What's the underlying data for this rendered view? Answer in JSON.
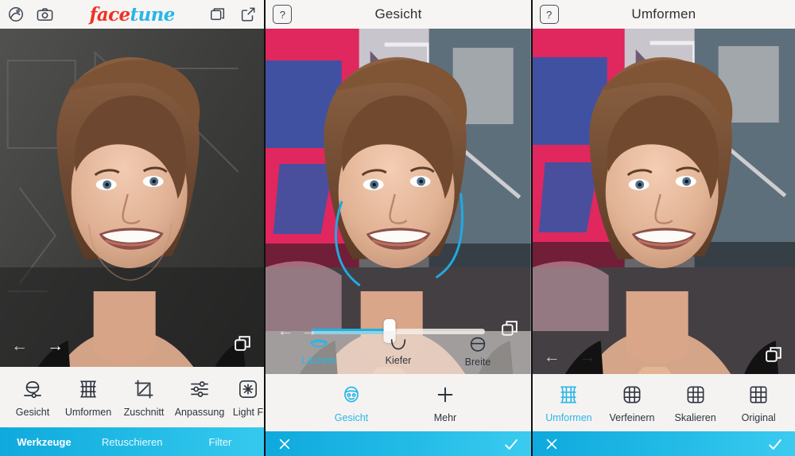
{
  "app": {
    "logo_face": "face",
    "logo_tune": "tune"
  },
  "panel1": {
    "top_icons": {
      "gallery": "gallery-icon",
      "camera": "camera-icon",
      "layers": "layers-icon",
      "share": "share-icon"
    },
    "overlay": {
      "undo": "←",
      "redo": "→",
      "compare": "compare-icon"
    },
    "tools": [
      {
        "label": "Gesicht",
        "icon": "face-slider-icon",
        "active": false
      },
      {
        "label": "Umformen",
        "icon": "warp-grid-icon",
        "active": false
      },
      {
        "label": "Zuschnitt",
        "icon": "crop-icon",
        "active": false
      },
      {
        "label": "Anpassung",
        "icon": "sliders-icon",
        "active": false
      },
      {
        "label": "Light F",
        "icon": "lightfx-icon",
        "active": false
      }
    ],
    "tabs": [
      {
        "label": "Werkzeuge",
        "active": true
      },
      {
        "label": "Retuschieren",
        "active": false
      },
      {
        "label": "Filter",
        "active": false
      }
    ]
  },
  "panel2": {
    "help": "?",
    "title": "Gesicht",
    "overlay": {
      "undo": "←",
      "redo": "→",
      "compare": "compare-icon"
    },
    "slider": {
      "value": 45,
      "min": 0,
      "max": 100
    },
    "subtools": [
      {
        "label": "Lächeln",
        "icon": "smile-icon",
        "active": true
      },
      {
        "label": "Kiefer",
        "icon": "jaw-icon",
        "active": false
      },
      {
        "label": "Breite",
        "icon": "width-icon",
        "active": false
      }
    ],
    "tools": [
      {
        "label": "Gesicht",
        "icon": "face-icon",
        "active": true
      },
      {
        "label": "Mehr",
        "icon": "plus-icon",
        "active": false
      }
    ],
    "actions": {
      "cancel": "✕",
      "confirm": "✓"
    }
  },
  "panel3": {
    "help": "?",
    "title": "Umformen",
    "overlay": {
      "undo": "←",
      "redo": "→",
      "compare": "compare-icon"
    },
    "tools": [
      {
        "label": "Umformen",
        "icon": "warp-grid-icon",
        "active": true
      },
      {
        "label": "Verfeinern",
        "icon": "refine-grid-icon",
        "active": false
      },
      {
        "label": "Skalieren",
        "icon": "scale-grid-icon",
        "active": false
      },
      {
        "label": "Original",
        "icon": "original-grid-icon",
        "active": false
      }
    ],
    "actions": {
      "cancel": "✕",
      "confirm": "✓"
    }
  },
  "colors": {
    "accent": "#29b6e8",
    "logo_red": "#ef3124",
    "logo_blue": "#29b6e8",
    "bar_bg": "#f5f3f1",
    "guide_line": "#22a9e0"
  }
}
